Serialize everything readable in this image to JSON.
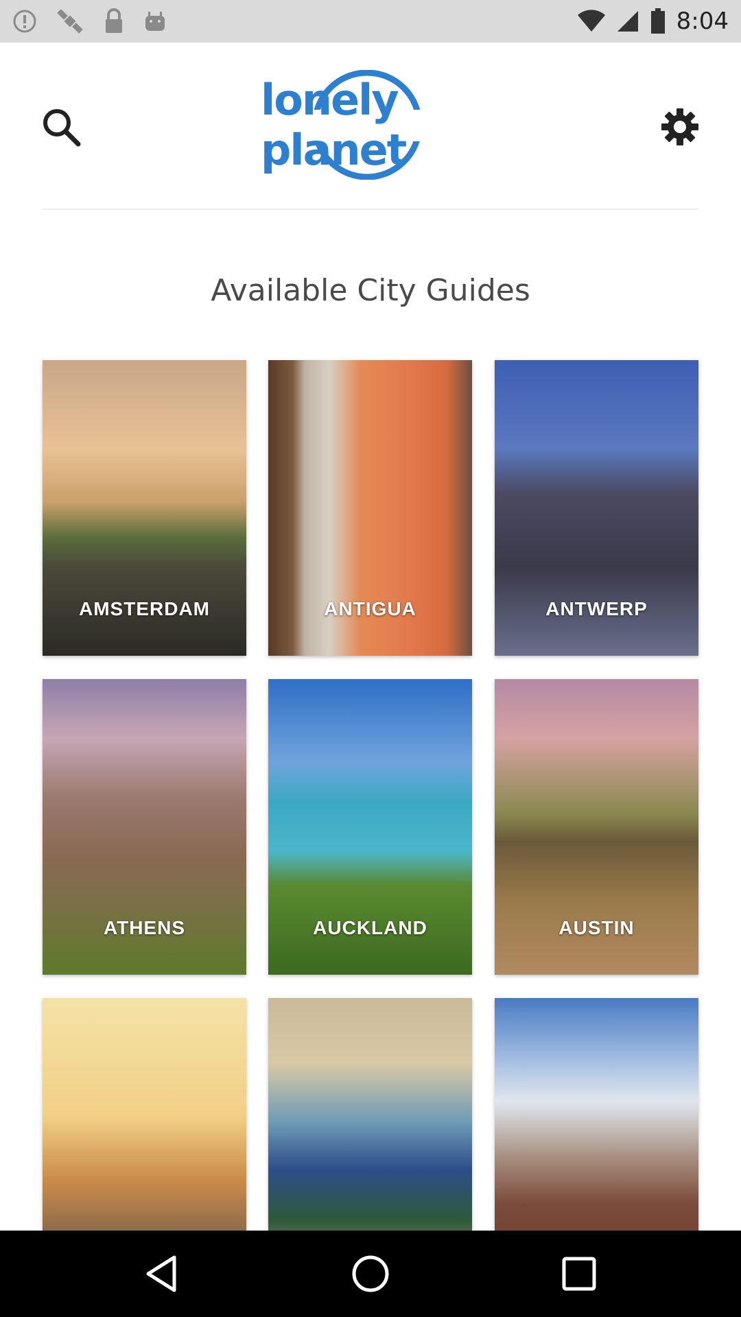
{
  "status_bar": {
    "time": "8:04",
    "left_icons": [
      "alert-icon",
      "satellite-icon",
      "lock-icon",
      "android-icon"
    ],
    "right_icons": [
      "wifi-icon",
      "cellular-icon",
      "battery-icon"
    ]
  },
  "header": {
    "logo_text": "lonely planet",
    "search_icon": "search-icon",
    "settings_icon": "gear-icon",
    "accent_color": "#2d7fd0"
  },
  "main": {
    "section_title": "Available City Guides",
    "cities": [
      {
        "label": "AMSTERDAM"
      },
      {
        "label": "ANTIGUA"
      },
      {
        "label": "ANTWERP"
      },
      {
        "label": "ATHENS"
      },
      {
        "label": "AUCKLAND"
      },
      {
        "label": "AUSTIN"
      },
      {
        "label": ""
      },
      {
        "label": ""
      },
      {
        "label": ""
      }
    ]
  },
  "nav_bar": {
    "buttons": [
      "back-icon",
      "home-icon",
      "recents-icon"
    ]
  }
}
